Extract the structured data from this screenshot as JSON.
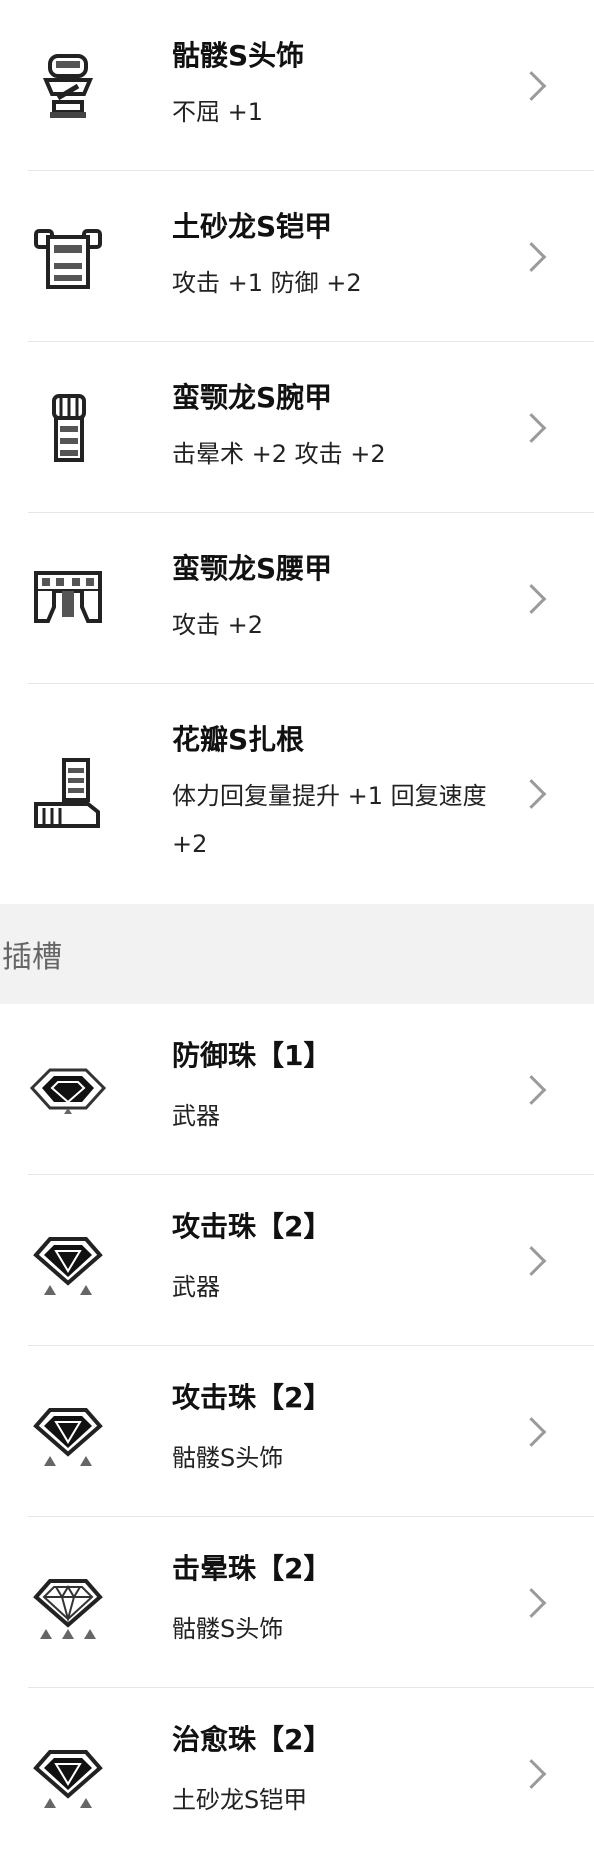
{
  "armor": [
    {
      "name": "骷髅S头饰",
      "effect": "不屈 +1",
      "icon": "helmet-icon"
    },
    {
      "name": "土砂龙S铠甲",
      "effect": "攻击 +1  防御 +2",
      "icon": "chest-armor-icon"
    },
    {
      "name": "蛮颚龙S腕甲",
      "effect": "击晕术 +2  攻击 +2",
      "icon": "gauntlet-icon"
    },
    {
      "name": "蛮颚龙S腰甲",
      "effect": "攻击 +2",
      "icon": "waist-armor-icon"
    },
    {
      "name": "花瓣S扎根",
      "effect": "体力回复量提升 +1  回复速度 +2",
      "icon": "greaves-icon"
    }
  ],
  "section": {
    "slots_label": "插槽"
  },
  "decorations": [
    {
      "name": "防御珠【1】",
      "target": "武器",
      "icon": "gem-icon"
    },
    {
      "name": "攻击珠【2】",
      "target": "武器",
      "icon": "gem-icon"
    },
    {
      "name": "攻击珠【2】",
      "target": "骷髅S头饰",
      "icon": "gem-icon"
    },
    {
      "name": "击晕珠【2】",
      "target": "骷髅S头饰",
      "icon": "gem-icon"
    },
    {
      "name": "治愈珠【2】",
      "target": "土砂龙S铠甲",
      "icon": "gem-icon"
    }
  ]
}
